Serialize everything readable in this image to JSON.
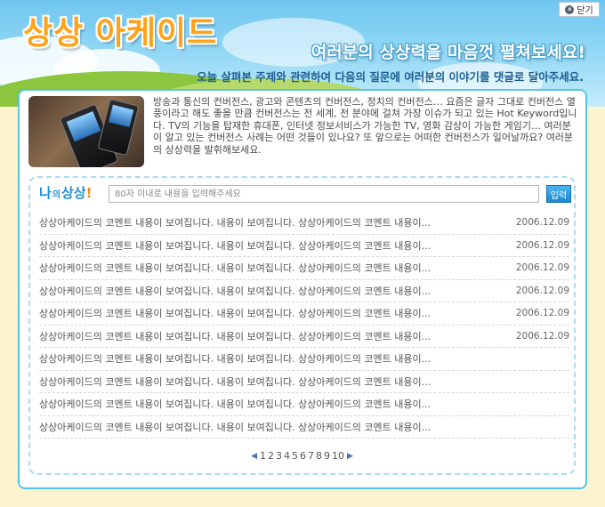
{
  "header": {
    "close_label": "닫기",
    "logo": "상상 아케이드",
    "slogan": "여러분의 상상력을 마음껏 펼쳐보세요!",
    "subline": "오늘 살펴본 주제와 관련하여 다음의 질문에 여러분의 이야기를 댓글로 달아주세요."
  },
  "intro": {
    "text": "방송과 통신의 컨버전스, 광고와 콘텐츠의 컨버전스, 정치의 컨버전스… 요즘은 글자 그대로 컨버전스 열풍이라고 해도 좋을 만큼 컨버전스는 전 세계, 전 분야에 걸쳐 가장 이슈가 되고 있는 Hot Keyword입니다. TV의 기능을 탑재한 휴대폰, 인터넷 정보서비스가 가능한 TV, 영화 감상이 가능한 게임기… 여러분이 알고 있는 컨버전스 사례는 어떤 것들이 있나요? 또 앞으로는 어떠한 컨버전스가 일어날까요? 여러분의 상상력을 발휘해보세요."
  },
  "comment_form": {
    "label_big": "나",
    "label_small": "의",
    "label_rest": "상상",
    "label_mark": "!",
    "placeholder": "80자 이내로 내용을 입력해주세요",
    "submit_label": "입력"
  },
  "comments": [
    {
      "text": "상상아케이드의 코멘트 내용이 보여집니다. 내용이 보여집니다. 상상아케이드의 코멘트 내용이...",
      "date": "2006.12.09"
    },
    {
      "text": "상상아케이드의 코멘트 내용이 보여집니다. 내용이 보여집니다. 상상아케이드의 코멘트 내용이...",
      "date": "2006.12.09"
    },
    {
      "text": "상상아케이드의 코멘트 내용이 보여집니다. 내용이 보여집니다. 상상아케이드의 코멘트 내용이...",
      "date": "2006.12.09"
    },
    {
      "text": "상상아케이드의 코멘트 내용이 보여집니다. 내용이 보여집니다. 상상아케이드의 코멘트 내용이...",
      "date": "2006.12.09"
    },
    {
      "text": "상상아케이드의 코멘트 내용이 보여집니다. 내용이 보여집니다. 상상아케이드의 코멘트 내용이...",
      "date": "2006.12.09"
    },
    {
      "text": "상상아케이드의 코멘트 내용이 보여집니다. 내용이 보여집니다. 상상아케이드의 코멘트 내용이...",
      "date": "2006.12.09"
    },
    {
      "text": "상상아케이드의 코멘트 내용이 보여집니다. 내용이 보여집니다. 상상아케이드의 코멘트 내용이...",
      "date": ""
    },
    {
      "text": "상상아케이드의 코멘트 내용이 보여집니다. 내용이 보여집니다. 상상아케이드의 코멘트 내용이...",
      "date": ""
    },
    {
      "text": "상상아케이드의 코멘트 내용이 보여집니다. 내용이 보여집니다. 상상아케이드의 코멘트 내용이...",
      "date": ""
    },
    {
      "text": "상상아케이드의 코멘트 내용이 보여집니다. 내용이 보여집니다. 상상아케이드의 코멘트 내용이...",
      "date": ""
    }
  ],
  "pagination": {
    "prev_icon": "triangle-left-icon",
    "next_icon": "triangle-right-icon",
    "pages": [
      "1",
      "2",
      "3",
      "4",
      "5",
      "6",
      "7",
      "8",
      "9",
      "10"
    ]
  },
  "colors": {
    "accent": "#1f8fd4",
    "panel_border": "#56c3e9",
    "logo": "#ffa21a",
    "page_bg": "#fdf3cf"
  }
}
